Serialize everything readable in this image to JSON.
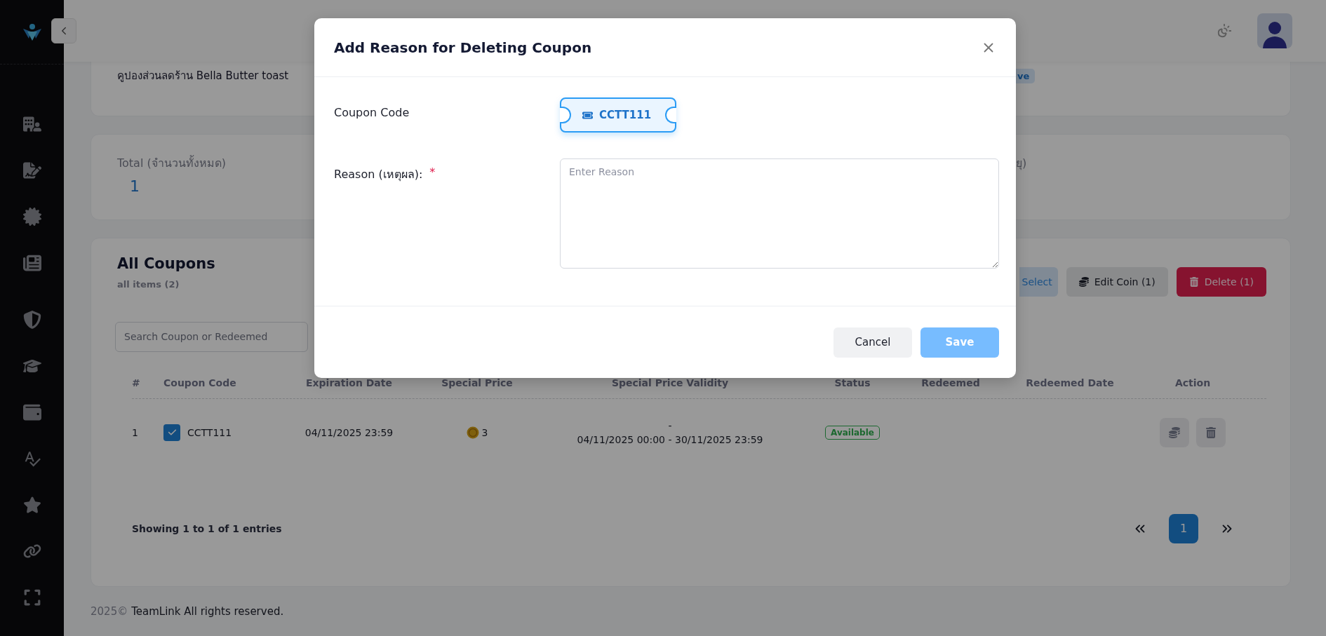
{
  "coupon_info": {
    "name": "คูปองส่วนลดร้าน Bella Butter toast",
    "status_badge": "ve"
  },
  "summary": {
    "total_label": "Total (จำนวนทั้งหมด)",
    "total_value": "1",
    "column_2_label": "ยุ)"
  },
  "coupons": {
    "title": "All Coupons",
    "subtitle": "all items (2)",
    "buttons": [
      {
        "label": "Select",
        "kind": "select"
      },
      {
        "label": "Edit Coin (1)",
        "kind": "edit"
      },
      {
        "label": "Delete (1)",
        "kind": "delete"
      }
    ],
    "search": {
      "placeholder": "Search Coupon or Redeemed"
    },
    "table": {
      "columns": [
        "#",
        "Coupon Code",
        "Expiration Date",
        "Special Price",
        "Special Price Validity",
        "Status",
        "Redeemed",
        "Redeemed Date",
        "Action"
      ],
      "rows": [
        {
          "index": "1",
          "checked": true,
          "code": "CCTT111",
          "expiration": "04/11/2025 23:59",
          "special_price": "3",
          "validity_line_1": "-",
          "validity_line_2": "04/11/2025 00:00 - 30/11/2025 23:59",
          "status": "Available"
        }
      ]
    },
    "pagination": {
      "summary": "Showing 1 to 1 of 1 entries",
      "pages": [
        {
          "label": "1",
          "selected": true
        }
      ]
    }
  },
  "footer": {
    "year": "2025©",
    "text": "TeamLink All rights reserved."
  },
  "modal": {
    "title": "Add Reason for Deleting Coupon",
    "fields": [
      {
        "label": "Coupon Code",
        "kind": "ticket",
        "value": "CCTT111"
      },
      {
        "label": "Reason (เหตุผล):",
        "kind": "textarea",
        "required_mark": "*",
        "placeholder": "Enter Reason"
      }
    ],
    "buttons": [
      {
        "label": "Cancel",
        "kind": "secondary",
        "disabled": false
      },
      {
        "label": "Save",
        "kind": "primary",
        "disabled": true
      }
    ]
  }
}
